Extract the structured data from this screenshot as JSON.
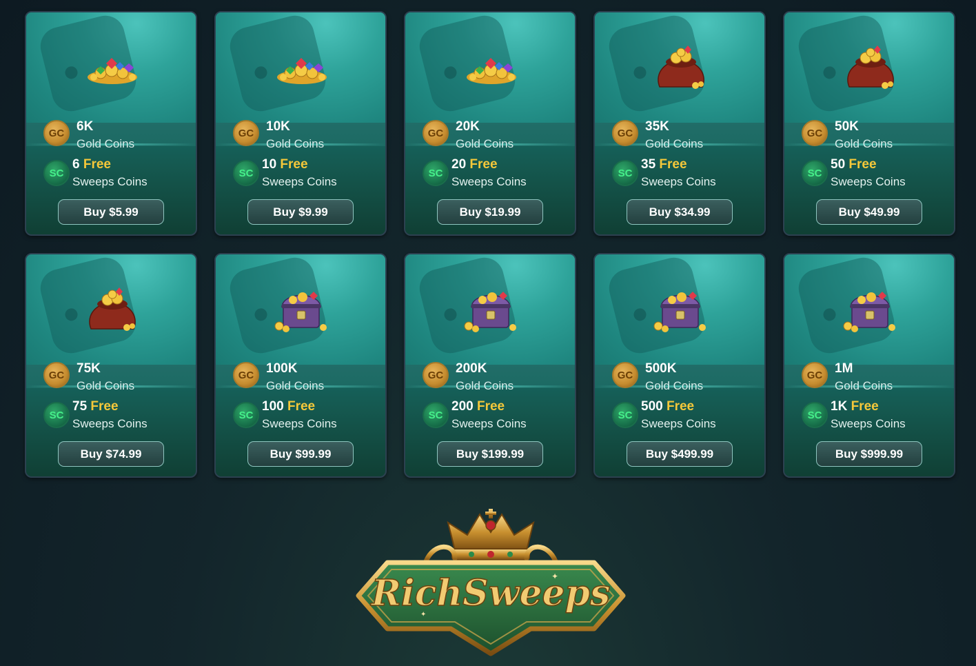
{
  "packages": [
    {
      "gc_amount": "6K",
      "gc_label": "Gold Coins",
      "sc_amount": "6",
      "sc_free": "Free",
      "sc_label": "Sweeps Coins",
      "buy_label": "Buy $5.99",
      "item_icon": "gem-pile-icon"
    },
    {
      "gc_amount": "10K",
      "gc_label": "Gold Coins",
      "sc_amount": "10",
      "sc_free": "Free",
      "sc_label": "Sweeps Coins",
      "buy_label": "Buy $9.99",
      "item_icon": "gem-pile-icon"
    },
    {
      "gc_amount": "20K",
      "gc_label": "Gold Coins",
      "sc_amount": "20",
      "sc_free": "Free",
      "sc_label": "Sweeps Coins",
      "buy_label": "Buy $19.99",
      "item_icon": "gem-pile-icon"
    },
    {
      "gc_amount": "35K",
      "gc_label": "Gold Coins",
      "sc_amount": "35",
      "sc_free": "Free",
      "sc_label": "Sweeps Coins",
      "buy_label": "Buy $34.99",
      "item_icon": "coin-sack-icon"
    },
    {
      "gc_amount": "50K",
      "gc_label": "Gold Coins",
      "sc_amount": "50",
      "sc_free": "Free",
      "sc_label": "Sweeps Coins",
      "buy_label": "Buy $49.99",
      "item_icon": "coin-sack-icon"
    },
    {
      "gc_amount": "75K",
      "gc_label": "Gold Coins",
      "sc_amount": "75",
      "sc_free": "Free",
      "sc_label": "Sweeps Coins",
      "buy_label": "Buy $74.99",
      "item_icon": "coin-sack-icon"
    },
    {
      "gc_amount": "100K",
      "gc_label": "Gold Coins",
      "sc_amount": "100",
      "sc_free": "Free",
      "sc_label": "Sweeps Coins",
      "buy_label": "Buy $99.99",
      "item_icon": "treasure-chest-icon"
    },
    {
      "gc_amount": "200K",
      "gc_label": "Gold Coins",
      "sc_amount": "200",
      "sc_free": "Free",
      "sc_label": "Sweeps Coins",
      "buy_label": "Buy $199.99",
      "item_icon": "treasure-chest-icon"
    },
    {
      "gc_amount": "500K",
      "gc_label": "Gold Coins",
      "sc_amount": "500",
      "sc_free": "Free",
      "sc_label": "Sweeps Coins",
      "buy_label": "Buy $499.99",
      "item_icon": "treasure-chest-icon"
    },
    {
      "gc_amount": "1M",
      "gc_label": "Gold Coins",
      "sc_amount": "1K",
      "sc_free": "Free",
      "sc_label": "Sweeps Coins",
      "buy_label": "Buy $999.99",
      "item_icon": "treasure-chest-icon"
    }
  ],
  "coin_badges": {
    "gc": "GC",
    "sc": "SC"
  },
  "logo": {
    "text": "RichSweeps"
  },
  "colors": {
    "free_accent": "#f5c83a",
    "sc_green": "#45f08a",
    "gold": "#c58c2f",
    "card_teal": "#1d7f7a"
  }
}
